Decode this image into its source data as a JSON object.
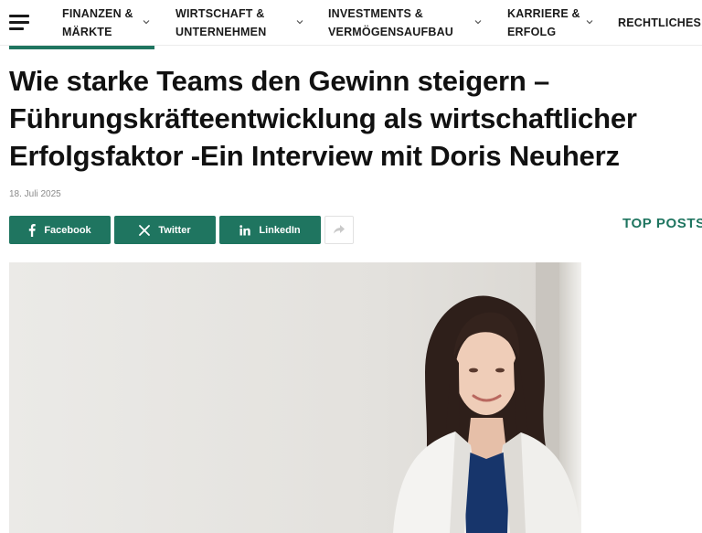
{
  "nav": {
    "menu_icon": "hamburger-menu-icon",
    "items": [
      {
        "line1": "FINANZEN &",
        "line2": "MÄRKTE"
      },
      {
        "line1": "WIRTSCHAFT &",
        "line2": "UNTERNEHMEN"
      },
      {
        "line1": "INVESTMENTS &",
        "line2": "VERMÖGENSAUFBAU"
      },
      {
        "line1": "KARRIERE &",
        "line2": "ERFOLG"
      },
      {
        "line1": "RECHTLICHES"
      }
    ],
    "dropdown_icon": "chevron-down-icon"
  },
  "article": {
    "title_lines": [
      "Wie starke Teams den Gewinn steigern –",
      "Führungskräfteentwicklung als wirtschaftlicher",
      "Erfolgsfaktor -Ein Interview mit Doris Neuherz"
    ],
    "date": "18. Juli 2025",
    "hero_image": "portrait-photo"
  },
  "share": {
    "buttons": [
      {
        "label": "Facebook",
        "icon": "facebook-icon"
      },
      {
        "label": "Twitter",
        "icon": "x-icon"
      },
      {
        "label": "LinkedIn",
        "icon": "linkedin-icon"
      }
    ],
    "more_icon": "share-arrow-icon"
  },
  "sidebar": {
    "heading": "TOP POSTS"
  },
  "colors": {
    "brand": "#1f7560",
    "text": "#111111",
    "muted": "#8a8a8a"
  }
}
